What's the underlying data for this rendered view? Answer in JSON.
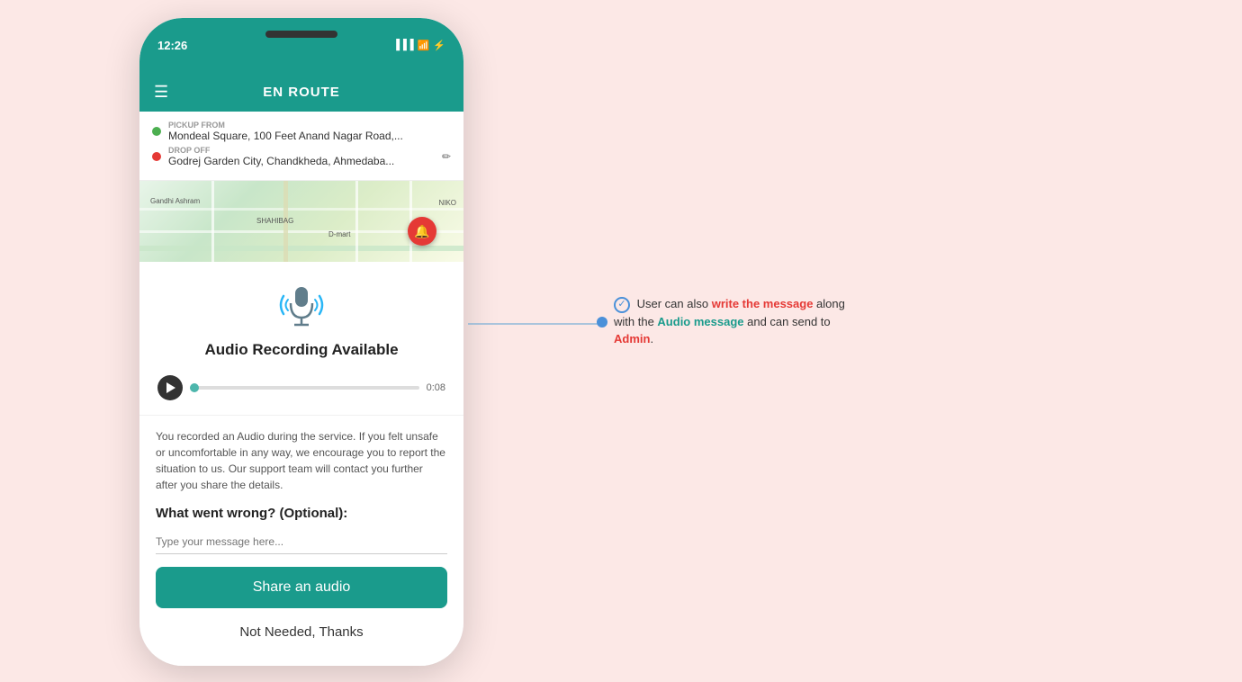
{
  "status_bar": {
    "time": "12:26",
    "battery_icon": "⚡",
    "wifi_icon": "wifi"
  },
  "header": {
    "title": "EN ROUTE",
    "hamburger": "☰"
  },
  "route": {
    "pickup_label": "PICKUP FROM",
    "pickup_address": "Mondeal Square, 100 Feet Anand Nagar Road,...",
    "dropoff_label": "DROP OFF",
    "dropoff_address": "Godrej Garden City, Chandkheda, Ahmedaba..."
  },
  "audio_section": {
    "title": "Audio Recording Available",
    "time": "0:08"
  },
  "body": {
    "description": "You recorded an Audio during the service. If you felt unsafe or uncomfortable in any way, we encourage you to report the situation to us. Our support team will contact you further after you share the details.",
    "optional_title": "What went wrong? (Optional):",
    "input_placeholder": "Type your message here...",
    "share_button": "Share an audio",
    "not_needed": "Not Needed, Thanks"
  },
  "annotation": {
    "text_before": "User can also ",
    "highlight_write": "write the message",
    "text_middle": " along with the ",
    "highlight_audio": "Audio message",
    "text_after": " and can send to ",
    "highlight_admin": "Admin",
    "text_end": ".",
    "check_symbol": "✓"
  }
}
